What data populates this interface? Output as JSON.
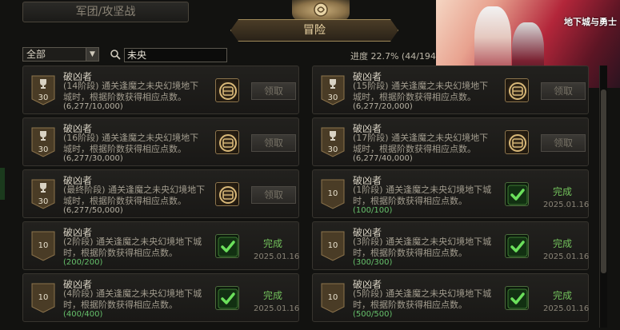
{
  "top_tab": {
    "label": "军团/攻坚战"
  },
  "section_title": "冒险",
  "filter": {
    "selected": "全部"
  },
  "search": {
    "value": "未央"
  },
  "progress_text": "进度 22.7% (44/194)",
  "promo": {
    "logo_text": "地下城与勇士"
  },
  "achievements": [
    {
      "title": "破凶者",
      "desc": "(14阶段) 通关逢魔之未央幻境地下城时，根据阶数获得相应点数。",
      "progress": "(6,277/10,000)",
      "level": "30",
      "status": "claim",
      "button": "领取"
    },
    {
      "title": "破凶者",
      "desc": "(15阶段) 通关逢魔之未央幻境地下城时，根据阶数获得相应点数。",
      "progress": "(6,277/20,000)",
      "level": "30",
      "status": "claim",
      "button": "领取"
    },
    {
      "title": "破凶者",
      "desc": "(16阶段) 通关逢魔之未央幻境地下城时，根据阶数获得相应点数。",
      "progress": "(6,277/30,000)",
      "level": "30",
      "status": "claim",
      "button": "领取"
    },
    {
      "title": "破凶者",
      "desc": "(17阶段) 通关逢魔之未央幻境地下城时，根据阶数获得相应点数。",
      "progress": "(6,277/40,000)",
      "level": "30",
      "status": "claim",
      "button": "领取"
    },
    {
      "title": "破凶者",
      "desc": "(最终阶段) 通关逢魔之未央幻境地下城时，根据阶数获得相应点数。",
      "progress": "(6,277/50,000)",
      "level": "30",
      "status": "claim",
      "button": "领取"
    },
    {
      "title": "破凶者",
      "desc": "(1阶段) 通关逢魔之未央幻境地下城时，根据阶数获得相应点数。",
      "progress": "(100/100)",
      "level": "10",
      "status": "done",
      "done_label": "完成",
      "date": "2025.01.16"
    },
    {
      "title": "破凶者",
      "desc": "(2阶段) 通关逢魔之未央幻境地下城时，根据阶数获得相应点数。",
      "progress": "(200/200)",
      "level": "10",
      "status": "done",
      "done_label": "完成",
      "date": "2025.01.16"
    },
    {
      "title": "破凶者",
      "desc": "(3阶段) 通关逢魔之未央幻境地下城时，根据阶数获得相应点数。",
      "progress": "(300/300)",
      "level": "10",
      "status": "done",
      "done_label": "完成",
      "date": "2025.01.16"
    },
    {
      "title": "破凶者",
      "desc": "(4阶段) 通关逢魔之未央幻境地下城时，根据阶数获得相应点数。",
      "progress": "(400/400)",
      "level": "10",
      "status": "done",
      "done_label": "完成",
      "date": "2025.01.16"
    },
    {
      "title": "破凶者",
      "desc": "(5阶段) 通关逢魔之未央幻境地下城时，根据阶数获得相应点数。",
      "progress": "(500/500)",
      "level": "10",
      "status": "done",
      "done_label": "完成",
      "date": "2025.01.16"
    }
  ]
}
